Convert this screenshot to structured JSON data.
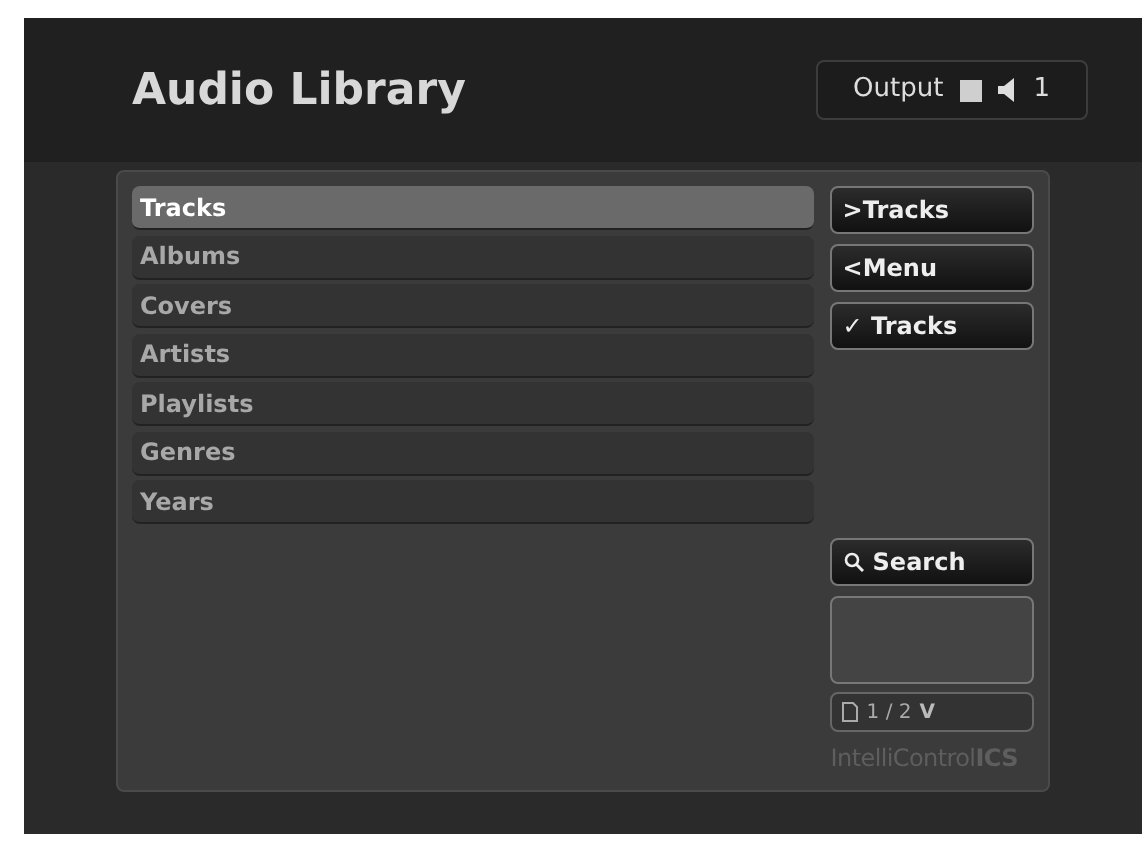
{
  "header": {
    "title": "Audio Library",
    "output": {
      "label": "Output",
      "zone": "1"
    }
  },
  "menu": [
    {
      "label": "Tracks",
      "selected": true
    },
    {
      "label": "Albums",
      "selected": false
    },
    {
      "label": "Covers",
      "selected": false
    },
    {
      "label": "Artists",
      "selected": false
    },
    {
      "label": "Playlists",
      "selected": false
    },
    {
      "label": "Genres",
      "selected": false
    },
    {
      "label": "Years",
      "selected": false
    }
  ],
  "actions": [
    {
      "kind": "forward",
      "glyph": ">",
      "label": "Tracks"
    },
    {
      "kind": "back",
      "glyph": "<",
      "label": "Menu"
    },
    {
      "kind": "check",
      "glyph": "✓",
      "label": "Tracks"
    }
  ],
  "search": {
    "label": "Search"
  },
  "pager": {
    "page": "1 / 2",
    "glyph": "V"
  },
  "brand": "IntelliControl**ICS**"
}
